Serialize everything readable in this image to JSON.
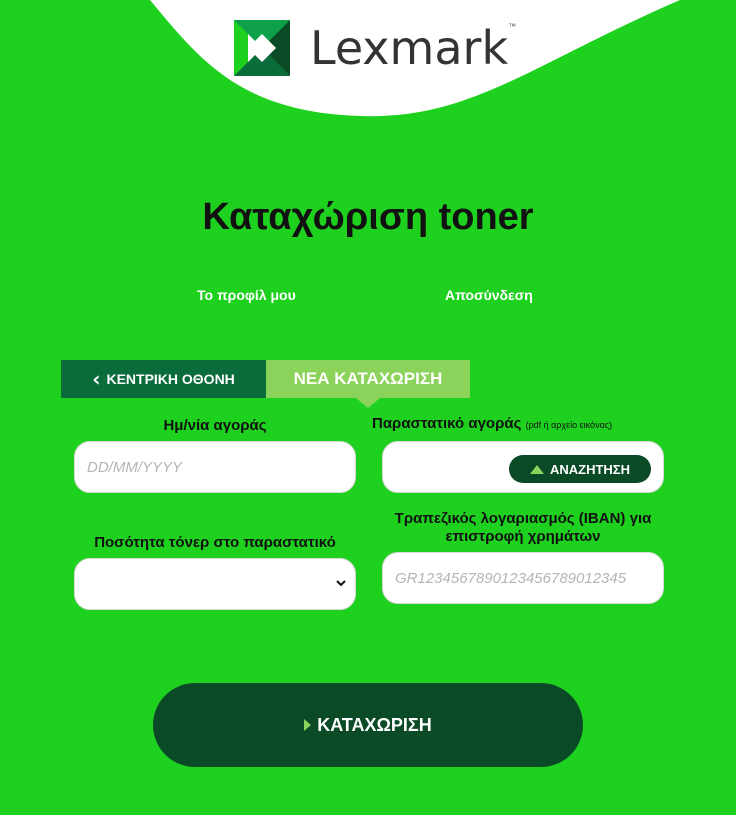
{
  "brand": {
    "logo_text": "Lexmark",
    "tm": "™",
    "color": "#1fd11f"
  },
  "page": {
    "title": "Καταχώριση toner"
  },
  "nav": {
    "profile": "Το προφίλ μου",
    "logout": "Αποσύνδεση"
  },
  "tabs": {
    "home": "ΚΕΝΤΡΙΚΗ ΟΘΟΝΗ",
    "new": "ΝΕΑ ΚΑΤΑΧΩΡΙΣΗ",
    "home_icon": "chevron-left-icon"
  },
  "form": {
    "purchase_date_label": "Ημ/νία αγοράς",
    "purchase_date_placeholder": "DD/MM/YYYY",
    "receipt_label": "Παραστατικό αγοράς",
    "receipt_hint": "(pdf ή αρχείο εικόνας)",
    "search_button": "ΑΝΑΖΗΤΗΣΗ",
    "quantity_label": "Ποσότητα τόνερ στο παραστατικό",
    "quantity_value": "",
    "iban_label_line1": "Τραπεζικός λογαριασμός (IBAN) για",
    "iban_label_line2": "επιστροφή χρημάτων",
    "iban_placeholder": "GR1234567890123456789012345"
  },
  "submit": {
    "label": "ΚΑΤΑΧΩΡΙΣΗ"
  },
  "colors": {
    "dark_green": "#0a4a26",
    "tab_green": "#0a6b3b",
    "light_green": "#8bd35a"
  }
}
